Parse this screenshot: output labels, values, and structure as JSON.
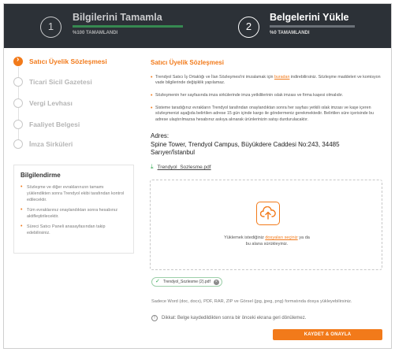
{
  "header": {
    "step1": {
      "number": "1",
      "title": "Bilgilerini Tamamla",
      "progress_text": "%100 TAMAMLANDI",
      "progress": 1.0
    },
    "step2": {
      "number": "2",
      "title": "Belgelerini Yükle",
      "progress_text": "%0 TAMAMLANDI",
      "progress": 0.0
    }
  },
  "sidebar": {
    "steps": [
      {
        "label": "Satıcı Üyelik Sözleşmesi",
        "active": true
      },
      {
        "label": "Ticari Sicil Gazetesi",
        "active": false
      },
      {
        "label": "Vergi Levhası",
        "active": false
      },
      {
        "label": "Faaliyet Belgesi",
        "active": false
      },
      {
        "label": "İmza Sirküleri",
        "active": false
      }
    ],
    "info": {
      "title": "Bilgilendirme",
      "items": [
        "Sözleşme ve diğer evraklarınızın tamamı yüklendikten sonra Trendyol ekibi tarafından kontrol edilecektir.",
        "Tüm evraklarınız onaylandıktan sonra hesabınız aktifleştirilecektir.",
        "Süreci Satıcı Paneli anasayfasından takip edebilirsiniz."
      ]
    }
  },
  "main": {
    "title": "Satıcı Üyelik Sözleşmesi",
    "bullet1_a": "Trendyol Satıcı İş Ortaklığı ve İlan Sözleşmesi'ni imzalamak için ",
    "bullet1_link": "buradan",
    "bullet1_b": " indirebilirsiniz. Sözleşme maddeleri ve komisyon vade bilgilerinde değişiklik yapılamaz.",
    "bullet2": "Sözleşmenin her sayfasında imza sirkülerinde imza yetkililerinin ıslak imzası ve firma kaşesi olmalıdır.",
    "bullet3": "Sisteme taradığınız evrakların Trendyol tarafından onaylandıktan sonra her sayfası yetkili ıslak imzası ve kaşe içeren sözleşmenizi aşağıda belirtilen adrese 15 gün içinde kargo ile göndermeniz gerekmektedir. Belirtilen süre içerisinde bu adrese ulaştırılmazsa hesabınız askıya alınarak ürünlerinizin satışı durdurulacaktır.",
    "address_label": "Adres:",
    "address_line1": "Spine Tower, Trendyol Campus, Büyükdere Caddesi No:243, 34485",
    "address_line2": "Sarıyer/İstanbul",
    "download_file": "Trendyol_Sozlesme.pdf",
    "drop_text_a": "Yüklemek istediğiniz ",
    "drop_link": "dosyaları seçiniz",
    "drop_text_b": " ya da",
    "drop_text_c": "bu alana sürükleyiniz.",
    "uploaded_file": "Trendyol_Sozlesme (2).pdf",
    "formats_note": "Sadece Word (doc, docx), PDF, RAR, ZIP ve Görsel (jpg, jpeg, png) formatında dosya yükleyebilirsiniz.",
    "warning": "Dikkat: Belge kaydedildikten sonra bir önceki ekrana geri dönülemez.",
    "save_button": "KAYDET & ONAYLA"
  },
  "colors": {
    "accent": "#f27a1a",
    "header_bg": "#2c3137",
    "success": "#3aa75a"
  }
}
